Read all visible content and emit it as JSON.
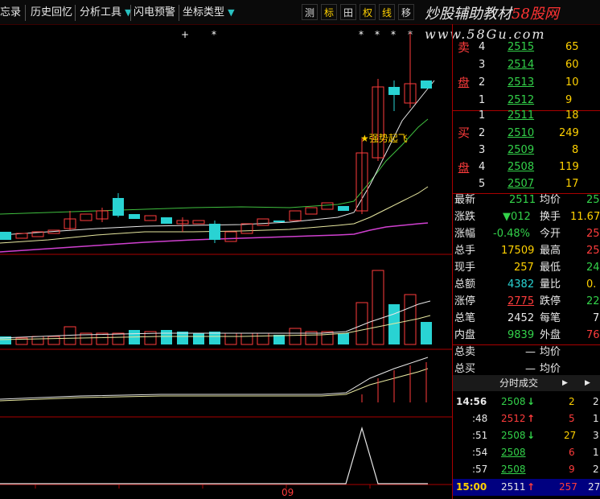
{
  "toolbar": {
    "items": [
      "忘录",
      "历史回忆",
      "分析工具",
      "闪电预警",
      "坐标类型"
    ],
    "buttons": [
      "测",
      "标",
      "田",
      "权",
      "线",
      "移"
    ],
    "active_button": "标"
  },
  "watermark": {
    "line1_a": "炒股辅助教材",
    "line1_b": "58股网",
    "line2": "www.58Gu.com"
  },
  "chart": {
    "annotation": "★强势起飞",
    "axis_label": "09",
    "star_marks": [
      "+",
      "*",
      "*",
      "*",
      "*",
      "*"
    ]
  },
  "order_book": {
    "sell_label_1": "卖",
    "sell_label_2": "盘",
    "buy_label_1": "买",
    "buy_label_2": "盘",
    "sell": [
      {
        "level": "4",
        "price": "2515",
        "vol": "65"
      },
      {
        "level": "3",
        "price": "2514",
        "vol": "60"
      },
      {
        "level": "2",
        "price": "2513",
        "vol": "10"
      },
      {
        "level": "1",
        "price": "2512",
        "vol": "9"
      }
    ],
    "buy": [
      {
        "level": "1",
        "price": "2511",
        "vol": "18"
      },
      {
        "level": "2",
        "price": "2510",
        "vol": "249"
      },
      {
        "level": "3",
        "price": "2509",
        "vol": "8"
      },
      {
        "level": "4",
        "price": "2508",
        "vol": "119"
      },
      {
        "level": "5",
        "price": "2507",
        "vol": "17"
      }
    ]
  },
  "stats": [
    {
      "l1": "最新",
      "v1": "2511",
      "l2": "均价",
      "v2": "25"
    },
    {
      "l1": "涨跌",
      "v1": "▼012",
      "l2": "换手",
      "v2": "11.67"
    },
    {
      "l1": "涨幅",
      "v1": "-0.48%",
      "l2": "今开",
      "v2": "25"
    },
    {
      "l1": "总手",
      "v1": "17509",
      "l2": "最高",
      "v2": "25"
    },
    {
      "l1": "现手",
      "v1": "257",
      "l2": "最低",
      "v2": "24"
    },
    {
      "l1": "总额",
      "v1": "4382",
      "l2": "量比",
      "v2": "0."
    },
    {
      "l1": "涨停",
      "v1": "2775",
      "l2": "跌停",
      "v2": "22"
    },
    {
      "l1": "总笔",
      "v1": "2452",
      "l2": "每笔",
      "v2": "7"
    },
    {
      "l1": "内盘",
      "v1": "9839",
      "l2": "外盘",
      "v2": "76"
    },
    {
      "l1": "总卖",
      "v1": "—",
      "l2": "均价",
      "v2": ""
    },
    {
      "l1": "总买",
      "v1": "—",
      "l2": "均价",
      "v2": ""
    }
  ],
  "ticks_header": "分时成交",
  "ticks": [
    {
      "time": "14:56",
      "price": "2508",
      "dir": "down",
      "vol": "2",
      "n": "2"
    },
    {
      "time": ":48",
      "price": "2512",
      "dir": "up",
      "vol": "5",
      "n": "1"
    },
    {
      "time": ":51",
      "price": "2508",
      "dir": "down",
      "vol": "27",
      "n": "3"
    },
    {
      "time": ":54",
      "price": "2508",
      "dir": "",
      "vol": "6",
      "n": "1"
    },
    {
      "time": ":57",
      "price": "2508",
      "dir": "",
      "vol": "9",
      "n": "2"
    },
    {
      "time": "15:00",
      "price": "2511",
      "dir": "up",
      "vol": "257",
      "n": "27"
    }
  ]
}
